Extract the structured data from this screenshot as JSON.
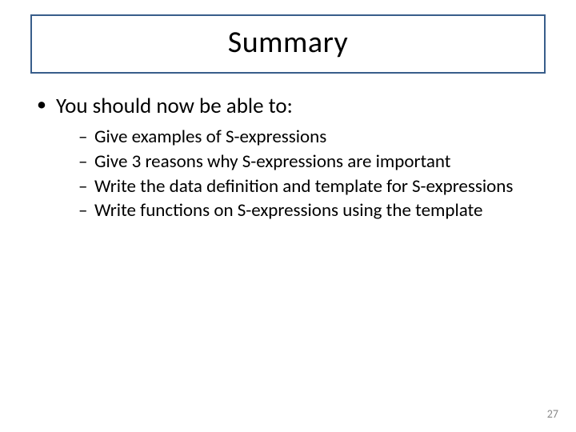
{
  "title": "Summary",
  "intro": "You should now be able to:",
  "bullets": [
    "Give examples of S-expressions",
    "Give 3 reasons why S-expressions are important",
    "Write the data definition and template for S-expressions",
    "Write functions on S-expressions using the template"
  ],
  "page_number": "27"
}
